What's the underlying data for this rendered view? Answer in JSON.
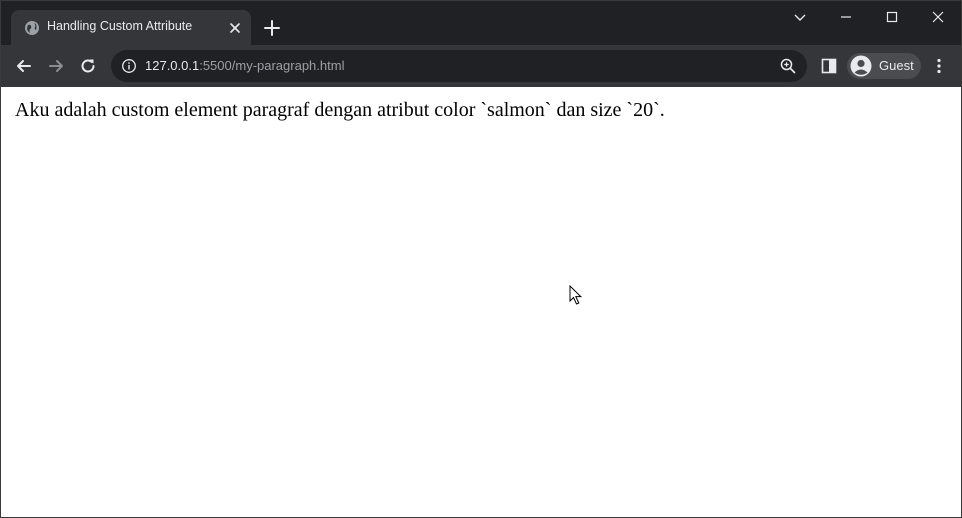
{
  "browser": {
    "tab": {
      "title": "Handling Custom Attribute",
      "favicon": "globe-icon"
    },
    "address_bar": {
      "host": "127.0.0.1",
      "path": ":5500/my-paragraph.html"
    },
    "profile": {
      "label": "Guest"
    },
    "colors": {
      "tabstrip_bg": "#202124",
      "toolbar_bg": "#35363a",
      "text": "#e8eaed",
      "muted_text": "#9aa0a6"
    }
  },
  "page": {
    "paragraph": "Aku adalah custom element paragraf dengan atribut color `salmon` dan size `20`."
  }
}
